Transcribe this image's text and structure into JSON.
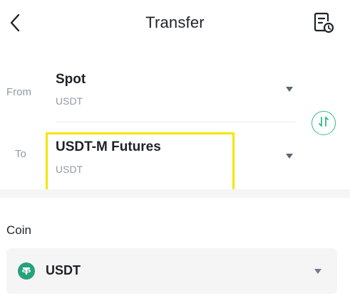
{
  "header": {
    "title": "Transfer",
    "back_icon": "chevron-left-icon",
    "history_icon": "document-clock-icon"
  },
  "transfer": {
    "from_label": "From",
    "to_label": "To",
    "from_account": {
      "title": "Spot",
      "asset": "USDT"
    },
    "to_account": {
      "title": "USDT-M Futures",
      "asset": "USDT"
    },
    "swap_icon": "swap-vertical-icon"
  },
  "coin": {
    "label": "Coin",
    "selected": "USDT",
    "icon": "tether-icon"
  },
  "colors": {
    "accent_green": "#2ebd85",
    "highlight_yellow": "#f3e600",
    "tether_green": "#26a17b",
    "text_primary": "#1e2329",
    "text_secondary": "#929aa5"
  }
}
